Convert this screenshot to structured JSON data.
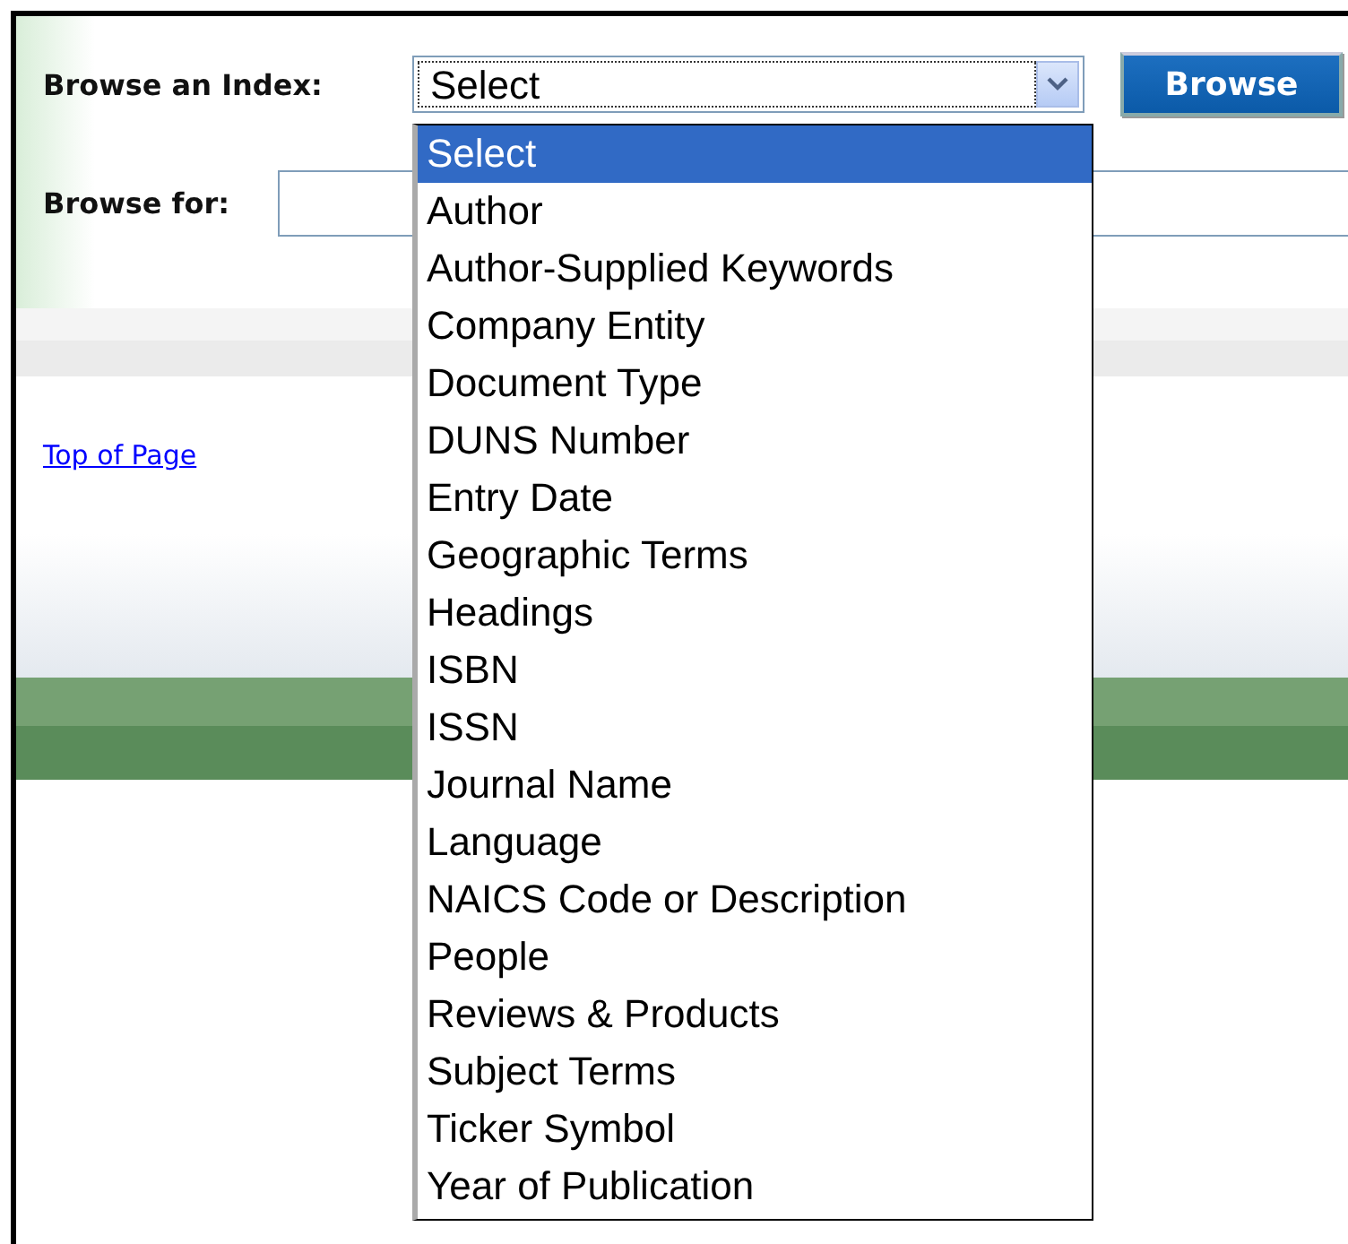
{
  "form": {
    "index_label": "Browse an Index:",
    "index_select": {
      "value": "Select",
      "expanded": true
    },
    "browse_button": "Browse",
    "browse_for_label": "Browse for:"
  },
  "dropdown_options": [
    {
      "label": "Select",
      "selected": true
    },
    {
      "label": "Author",
      "selected": false
    },
    {
      "label": "Author-Supplied Keywords",
      "selected": false
    },
    {
      "label": "Company Entity",
      "selected": false
    },
    {
      "label": "Document Type",
      "selected": false
    },
    {
      "label": "DUNS Number",
      "selected": false
    },
    {
      "label": "Entry Date",
      "selected": false
    },
    {
      "label": "Geographic Terms",
      "selected": false
    },
    {
      "label": "Headings",
      "selected": false
    },
    {
      "label": "ISBN",
      "selected": false
    },
    {
      "label": "ISSN",
      "selected": false
    },
    {
      "label": "Journal Name",
      "selected": false
    },
    {
      "label": "Language",
      "selected": false
    },
    {
      "label": "NAICS Code or Description",
      "selected": false
    },
    {
      "label": "People",
      "selected": false
    },
    {
      "label": "Reviews & Products",
      "selected": false
    },
    {
      "label": "Subject Terms",
      "selected": false
    },
    {
      "label": "Ticker Symbol",
      "selected": false
    },
    {
      "label": "Year of Publication",
      "selected": false
    }
  ],
  "top_link": "Top of Page"
}
